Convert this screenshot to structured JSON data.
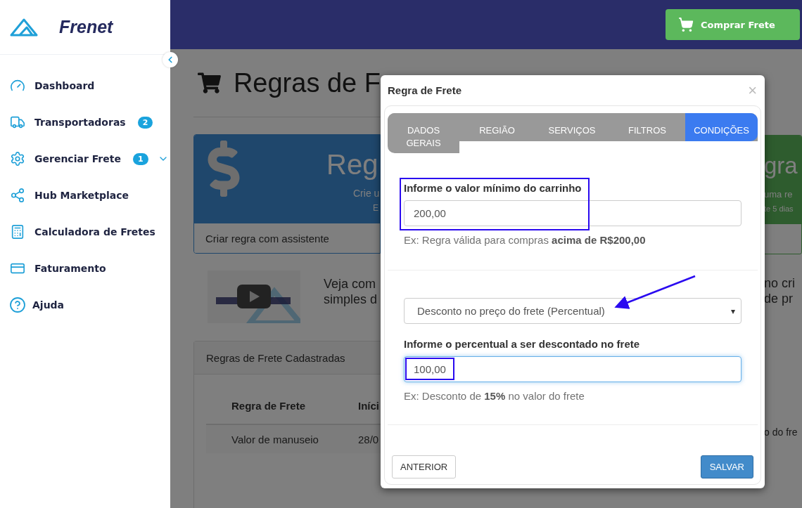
{
  "sidebar": {
    "logo": "Frenet",
    "items": [
      {
        "label": "Dashboard"
      },
      {
        "label": "Transportadoras",
        "badge": "2"
      },
      {
        "label": "Gerenciar Frete",
        "badge": "1",
        "expanded": false
      },
      {
        "label": "Hub Marketplace"
      },
      {
        "label": "Calculadora de Fretes"
      },
      {
        "label": "Faturamento"
      },
      {
        "label": "Ajuda"
      }
    ]
  },
  "header": {
    "buy_button": "Comprar Frete"
  },
  "background": {
    "page_title": "Regras de F",
    "left_card": {
      "title": "Reg",
      "line_1": "Crie u",
      "line_2": "E",
      "action": "Criar regra com assistente"
    },
    "right_card": {
      "title": "gra",
      "line_1": "uma re",
      "line_2": "te 5 dias"
    },
    "video_text_left": [
      "Veja com",
      "simples d"
    ],
    "video_text_right": [
      "no cri",
      "de pr"
    ],
    "panel": {
      "title": "Regras de Frete Cadastradas",
      "columns": [
        "Regra de Frete",
        "Iníci"
      ],
      "row_left": [
        "Valor de manuseio",
        "28/0"
      ],
      "row_right": "o do fre"
    }
  },
  "modal": {
    "title": "Regra de Frete",
    "close": "×",
    "tabs": [
      {
        "label": "DADOS GERAIS",
        "selected": false
      },
      {
        "label": "REGIÃO",
        "selected": false
      },
      {
        "label": "SERVIÇOS",
        "selected": false
      },
      {
        "label": "FILTROS",
        "selected": false
      },
      {
        "label": "CONDIÇÕES",
        "selected": true
      }
    ],
    "min_cart": {
      "label": "Informe o valor mínimo do carrinho",
      "value": "200,00",
      "help": "Ex: Regra válida para compras **acima de R$200,00**",
      "focused": false
    },
    "discount_type": {
      "value": "Desconto no preço do frete (Percentual)",
      "caret": "▾"
    },
    "percent": {
      "label": "Informe o percentual a ser descontado no frete",
      "value": "100,00",
      "help": "Ex: Desconto de **15%** no valor do frete",
      "focused": true
    },
    "back_button": "ANTERIOR",
    "save_button": "SALVAR"
  }
}
